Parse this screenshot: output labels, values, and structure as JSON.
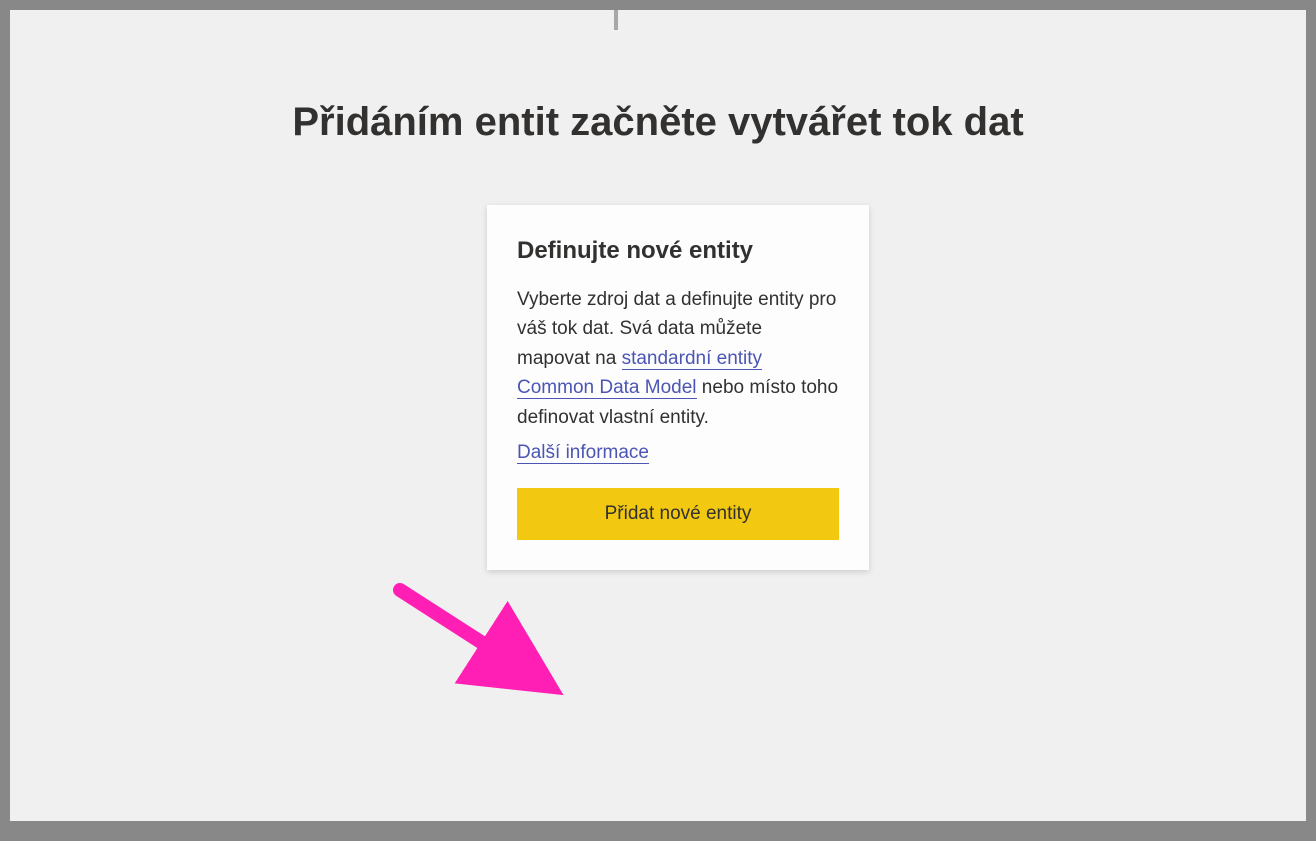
{
  "page": {
    "title": "Přidáním entit začněte vytvářet tok dat"
  },
  "card": {
    "title": "Definujte nové entity",
    "description_pre": "Vyberte zdroj dat a definujte entity pro váš tok dat. Svá data můžete mapovat na ",
    "link_cdm": "standardní entity Common Data Model",
    "description_post": " nebo místo toho definovat vlastní entity.",
    "more_info_link": "Další informace",
    "add_button_label": "Přidat nové entity"
  },
  "colors": {
    "accent": "#f2c811",
    "link": "#4b55b3",
    "annotation": "#ff1fb4"
  }
}
